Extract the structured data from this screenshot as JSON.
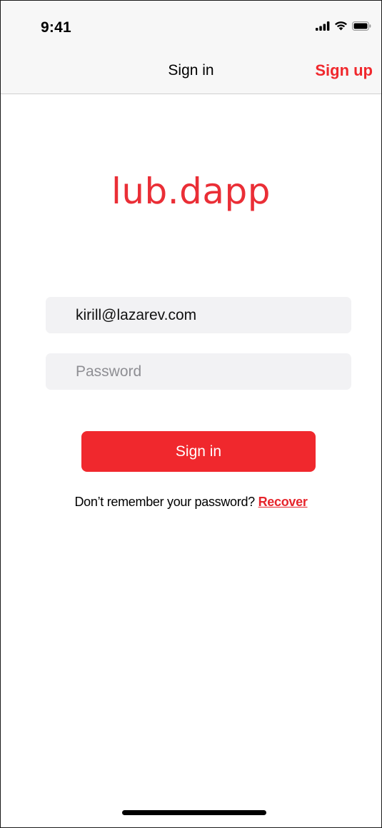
{
  "status_bar": {
    "time": "9:41",
    "icons": [
      "cellular-signal-icon",
      "wifi-icon",
      "battery-icon"
    ]
  },
  "nav": {
    "title": "Sign in",
    "action_label": "Sign up"
  },
  "logo": {
    "text": "lub.dapp"
  },
  "form": {
    "email_value": "kirill@lazarev.com",
    "password_placeholder": "Password",
    "submit_label": "Sign in"
  },
  "recover": {
    "prompt": "Don’t remember your password?",
    "link_label": "Recover"
  },
  "colors": {
    "accent": "#f0282d",
    "field_bg": "#f2f2f4",
    "bar_bg": "#f7f7f7",
    "placeholder": "#8e8e93"
  }
}
